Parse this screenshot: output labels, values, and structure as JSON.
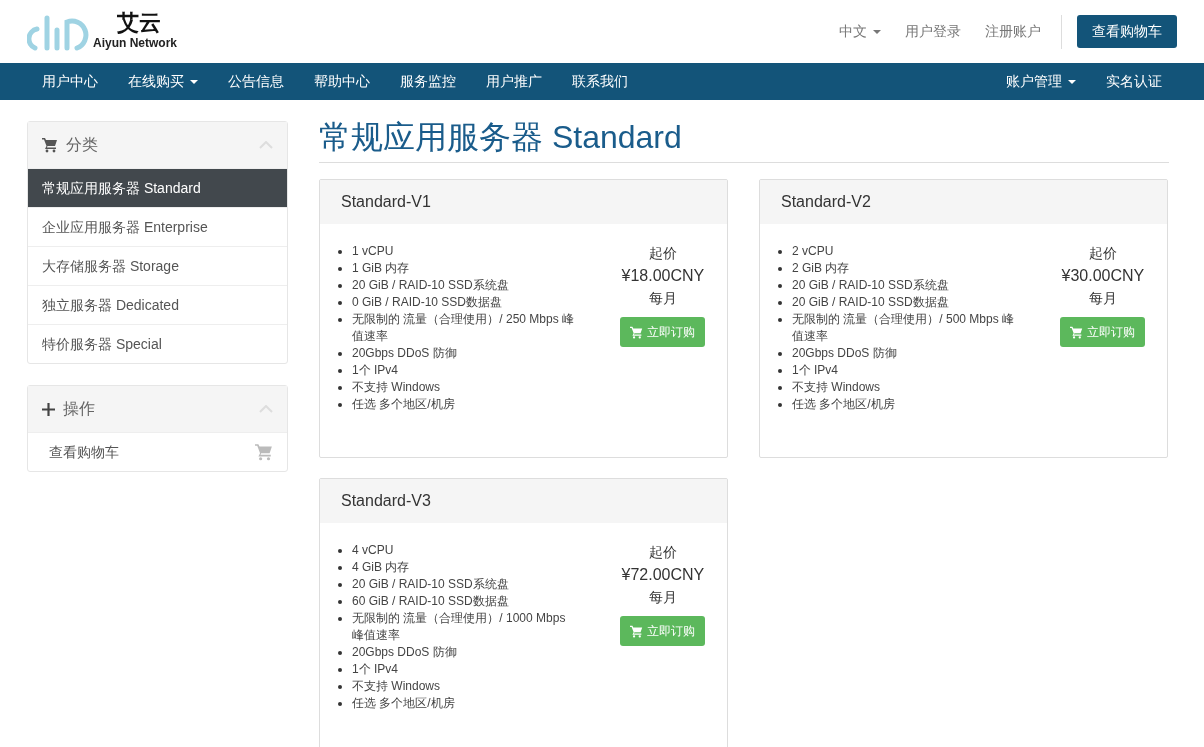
{
  "header": {
    "logo_name": "艾云",
    "logo_tagline": "Aiyun Network",
    "top_links": [
      {
        "label": "中文",
        "dropdown": true
      },
      {
        "label": "用户登录",
        "dropdown": false
      },
      {
        "label": "注册账户",
        "dropdown": false
      }
    ],
    "cart_button": "查看购物车"
  },
  "nav": {
    "left": [
      {
        "label": "用户中心",
        "dropdown": false
      },
      {
        "label": "在线购买",
        "dropdown": true
      },
      {
        "label": "公告信息",
        "dropdown": false
      },
      {
        "label": "帮助中心",
        "dropdown": false
      },
      {
        "label": "服务监控",
        "dropdown": false
      },
      {
        "label": "用户推广",
        "dropdown": false
      },
      {
        "label": "联系我们",
        "dropdown": false
      }
    ],
    "right": [
      {
        "label": "账户管理",
        "dropdown": true
      },
      {
        "label": "实名认证",
        "dropdown": false
      }
    ]
  },
  "sidebar": [
    {
      "title": "分类",
      "items": [
        {
          "label": "常规应用服务器 Standard",
          "selected": true
        },
        {
          "label": "企业应用服务器 Enterprise",
          "selected": false
        },
        {
          "label": "大存储服务器 Storage",
          "selected": false
        },
        {
          "label": "独立服务器 Dedicated",
          "selected": false
        },
        {
          "label": "特价服务器 Special",
          "selected": false
        }
      ]
    },
    {
      "title": "操作",
      "items": [
        {
          "label": "查看购物车",
          "selected": false
        }
      ]
    }
  ],
  "page_title": "常规应用服务器 Standard",
  "products": [
    {
      "name": "Standard-V1",
      "features": [
        "1 vCPU",
        "1 GiB 内存",
        "20 GiB / RAID-10 SSD系统盘",
        "0 GiB / RAID-10 SSD数据盘",
        "无限制的 流量（合理使用）/ 250 Mbps 峰值速率",
        "20Gbps DDoS 防御",
        "1个 IPv4",
        "不支持 Windows",
        "任选 多个地区/机房"
      ],
      "price_label": "起价",
      "price": "¥18.00CNY",
      "period": "每月",
      "order_button": "立即订购"
    },
    {
      "name": "Standard-V2",
      "features": [
        "2 vCPU",
        "2 GiB 内存",
        "20 GiB / RAID-10 SSD系统盘",
        "20 GiB / RAID-10 SSD数据盘",
        "无限制的 流量（合理使用）/ 500 Mbps 峰值速率",
        "20Gbps DDoS 防御",
        "1个 IPv4",
        "不支持 Windows",
        "任选 多个地区/机房"
      ],
      "price_label": "起价",
      "price": "¥30.00CNY",
      "period": "每月",
      "order_button": "立即订购"
    },
    {
      "name": "Standard-V3",
      "features": [
        "4 vCPU",
        "4 GiB 内存",
        "20 GiB / RAID-10 SSD系统盘",
        "60 GiB / RAID-10 SSD数据盘",
        "无限制的 流量（合理使用）/ 1000 Mbps 峰值速率",
        "20Gbps DDoS 防御",
        "1个 IPv4",
        "不支持 Windows",
        "任选 多个地区/机房"
      ],
      "price_label": "起价",
      "price": "¥72.00CNY",
      "period": "每月",
      "order_button": "立即订购"
    }
  ]
}
